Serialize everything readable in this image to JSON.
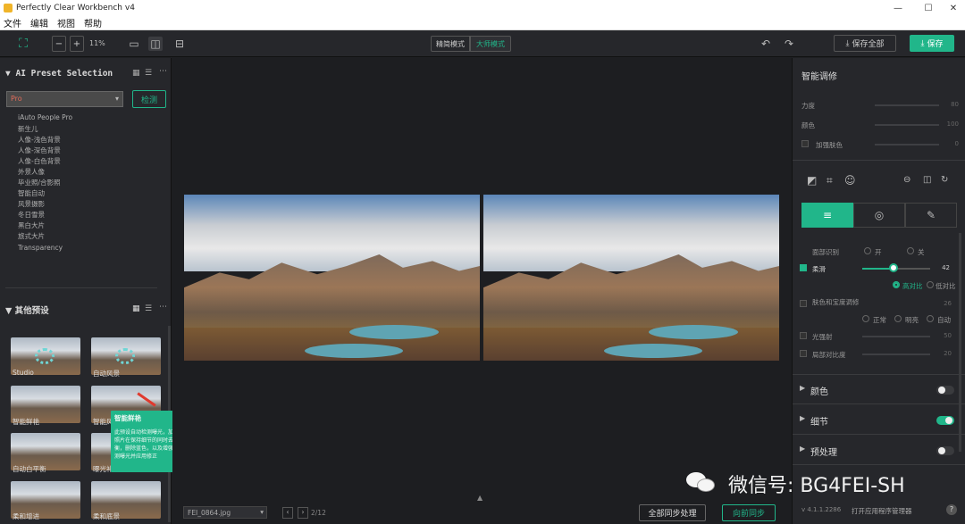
{
  "window": {
    "title": "Perfectly Clear Workbench v4",
    "minimize": "—",
    "maximize": "☐",
    "close": "✕"
  },
  "menu": [
    "文件",
    "编辑",
    "视图",
    "帮助"
  ],
  "toolbar": {
    "zoom_minus": "−",
    "zoom_plus": "+",
    "zoom_level": "11%",
    "mode_simple": "精简模式",
    "mode_pro": "大师模式",
    "save_all": "保存全部",
    "save": "保存"
  },
  "left": {
    "ai_title": "AI Preset Selection",
    "preset_select": "Pro",
    "detect_button": "检测",
    "presets": [
      "iAuto People Pro",
      "新生儿",
      "人像-浅色背景",
      "人像-深色背景",
      "人像-白色背景",
      "外景人像",
      "毕业照/合影照",
      "智能自动",
      "风景摄影",
      "冬日雪景",
      "黑白大片",
      "旅式大片",
      "Transparency"
    ],
    "other_title": "其他预设",
    "thumbs": [
      "Studio",
      "自动风景",
      "智能鲜艳",
      "智能风景",
      "自动白平衡",
      "曝光补偿",
      "柔和增进",
      "柔和底景"
    ],
    "tooltip_title": "智能鲜艳",
    "tooltip_text": "此预设自动检测曝光，加亮，提助的去噪点功能让照片在保持细节的同时去除颗粒噪点。根据白平衡，删除蓝色，以及增强相片的实际情况，自动检测曝光并应用修正"
  },
  "center": {
    "filename": "FEI_0864.jpg",
    "counter": "2/12",
    "sync_all": "全部同步处理",
    "sync_forward": "向前同步"
  },
  "right": {
    "title": "智能调修",
    "sliders": [
      {
        "label": "力度",
        "value": "80"
      },
      {
        "label": "颜色",
        "value": "100"
      },
      {
        "label": "加强肤色",
        "value": "0"
      }
    ],
    "scene_label": "面部识别",
    "radio_on": "开",
    "radio_off": "关",
    "strength_label": "柔滑",
    "strength_value": "42",
    "opt_a": "高对比",
    "opt_b": "低对比",
    "tint_label": "肤色和宝度调修",
    "tint_value": "26",
    "tone_labels": [
      "正常",
      "明亮",
      "自动"
    ],
    "light_label": "光强射",
    "light_value": "50",
    "contrast_label": "局部对比度",
    "contrast_value": "20",
    "accordion": [
      "颜色",
      "细节",
      "预处理"
    ],
    "version": "v 4.1.1.2286",
    "open_manager": "打开应用程序管理器",
    "help": "?"
  },
  "watermark": "微信号: BG4FEI-SH",
  "colors": {
    "accent": "#21b68a",
    "panel": "#26272b",
    "canvas": "#1d1e21"
  }
}
